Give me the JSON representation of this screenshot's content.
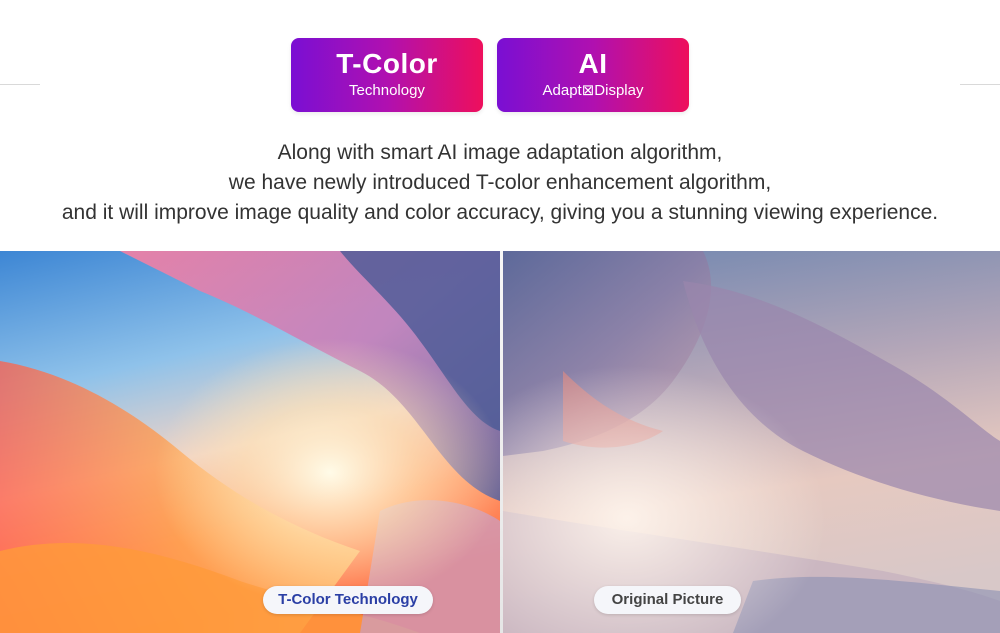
{
  "badges": [
    {
      "title": "T-Color",
      "subtitle": "Technology"
    },
    {
      "title": "AI",
      "subtitle": "Adapt⊠Display"
    }
  ],
  "description": {
    "lines": [
      "Along with smart AI image adaptation algorithm,",
      "we have newly introduced T-color enhancement algorithm,",
      "and it will improve image quality and color accuracy, giving you a stunning viewing experience."
    ]
  },
  "comparison": {
    "left_label": "T-Color Technology",
    "right_label": "Original Picture"
  },
  "colors": {
    "badge_gradient_start": "#7a0fd3",
    "badge_gradient_end": "#ee0f5c",
    "text": "#333333",
    "label_left_text": "#2b3fa5"
  }
}
